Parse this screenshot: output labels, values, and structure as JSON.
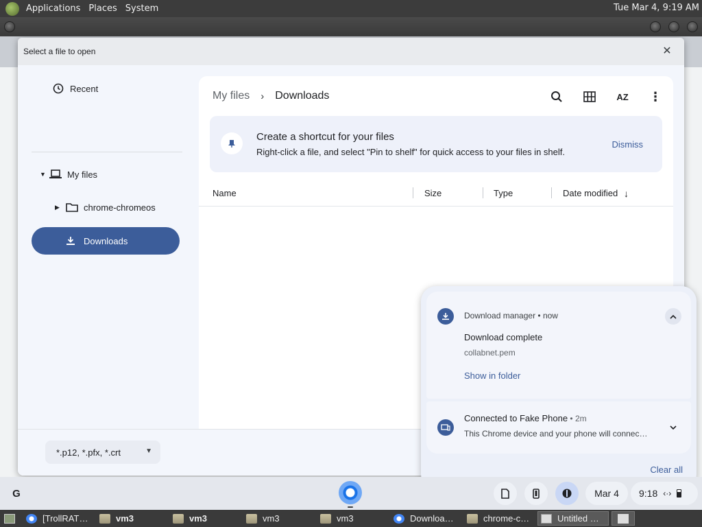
{
  "host_panel": {
    "menus": [
      "Applications",
      "Places",
      "System"
    ],
    "clock": "Tue Mar  4, 9:19 AM"
  },
  "dialog": {
    "title": "Select a file to open",
    "sidebar": {
      "recent": "Recent",
      "my_files": "My files",
      "chrome_folder": "chrome-chromeos",
      "downloads": "Downloads"
    },
    "breadcrumb": [
      "My files",
      "Downloads"
    ],
    "banner": {
      "title": "Create a shortcut for your files",
      "body": "Right-click a file, and select \"Pin to shelf\" for quick access to your files in shelf.",
      "dismiss": "Dismiss"
    },
    "columns": [
      "Name",
      "Size",
      "Type",
      "Date modified"
    ],
    "filter": "*.p12, *.pfx, *.crt"
  },
  "notifications": {
    "items": [
      {
        "source": "Download manager",
        "time": "now",
        "title": "Download complete",
        "body": "collabnet.pem",
        "action": "Show in folder"
      },
      {
        "source": "Connected to Fake Phone",
        "time": "2m",
        "body": "This Chrome device and your phone will connec…"
      }
    ],
    "clear_all": "Clear all"
  },
  "shelf": {
    "launcher": "G",
    "date": "Mar 4",
    "time": "9:18"
  },
  "taskbar": [
    {
      "label": "[TrollRAT…",
      "icon": "chrome-icon"
    },
    {
      "label": "vm3",
      "icon": "folder-icon",
      "bold": true
    },
    {
      "label": "vm3",
      "icon": "folder-icon",
      "bold": true
    },
    {
      "label": "vm3",
      "icon": "folder-icon"
    },
    {
      "label": "vm3",
      "icon": "folder-icon"
    },
    {
      "label": "Downloa…",
      "icon": "chrome-icon"
    },
    {
      "label": "chrome-c…",
      "icon": "folder-icon"
    },
    {
      "label": "Untitled …",
      "icon": "window-icon",
      "active": true
    }
  ],
  "colors": {
    "accent": "#3c5d9a",
    "dialog_bg": "#f3f6fc",
    "notification_bg": "#ecf0f9"
  }
}
